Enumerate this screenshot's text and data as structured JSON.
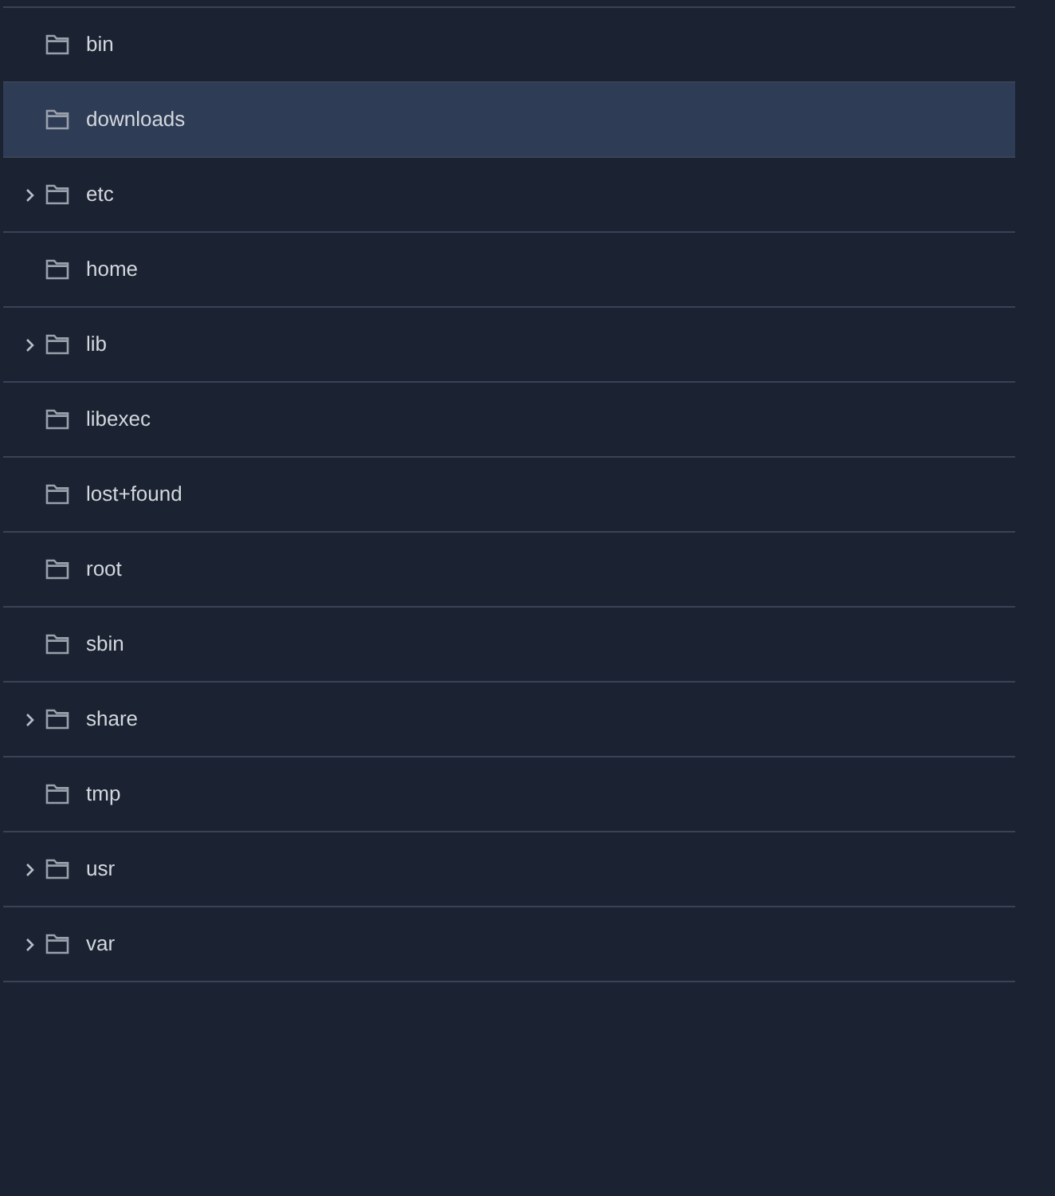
{
  "folders": [
    {
      "name": "bin",
      "expandable": false,
      "selected": false
    },
    {
      "name": "downloads",
      "expandable": false,
      "selected": true
    },
    {
      "name": "etc",
      "expandable": true,
      "selected": false
    },
    {
      "name": "home",
      "expandable": false,
      "selected": false
    },
    {
      "name": "lib",
      "expandable": true,
      "selected": false
    },
    {
      "name": "libexec",
      "expandable": false,
      "selected": false
    },
    {
      "name": "lost+found",
      "expandable": false,
      "selected": false
    },
    {
      "name": "root",
      "expandable": false,
      "selected": false
    },
    {
      "name": "sbin",
      "expandable": false,
      "selected": false
    },
    {
      "name": "share",
      "expandable": true,
      "selected": false
    },
    {
      "name": "tmp",
      "expandable": false,
      "selected": false
    },
    {
      "name": "usr",
      "expandable": true,
      "selected": false
    },
    {
      "name": "var",
      "expandable": true,
      "selected": false
    }
  ]
}
